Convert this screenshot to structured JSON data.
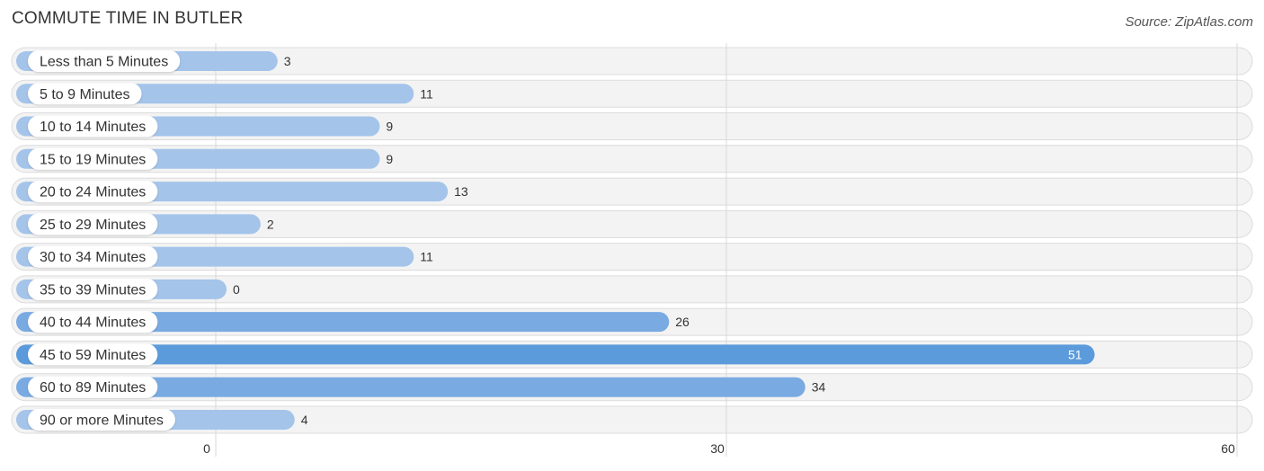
{
  "header": {
    "title": "COMMUTE TIME IN BUTLER",
    "source": "Source: ZipAtlas.com"
  },
  "colors": {
    "bar_light": "#a4c4ea",
    "bar_mid": "#7aaae2",
    "bar_highlight": "#5b9bdc",
    "row_background": "#f3f3f3"
  },
  "chart_data": {
    "type": "bar",
    "orientation": "horizontal",
    "title": "COMMUTE TIME IN BUTLER",
    "xlabel": "",
    "ylabel": "",
    "categories": [
      "Less than 5 Minutes",
      "5 to 9 Minutes",
      "10 to 14 Minutes",
      "15 to 19 Minutes",
      "20 to 24 Minutes",
      "25 to 29 Minutes",
      "30 to 34 Minutes",
      "35 to 39 Minutes",
      "40 to 44 Minutes",
      "45 to 59 Minutes",
      "60 to 89 Minutes",
      "90 or more Minutes"
    ],
    "values": [
      3,
      11,
      9,
      9,
      13,
      2,
      11,
      0,
      26,
      51,
      34,
      4
    ],
    "xlim": [
      0,
      60
    ],
    "xticks": [
      0,
      30,
      60
    ],
    "xtick_labels": [
      "0",
      "30",
      "60"
    ],
    "grid": true,
    "highlight_index": 9,
    "legend": "none"
  }
}
